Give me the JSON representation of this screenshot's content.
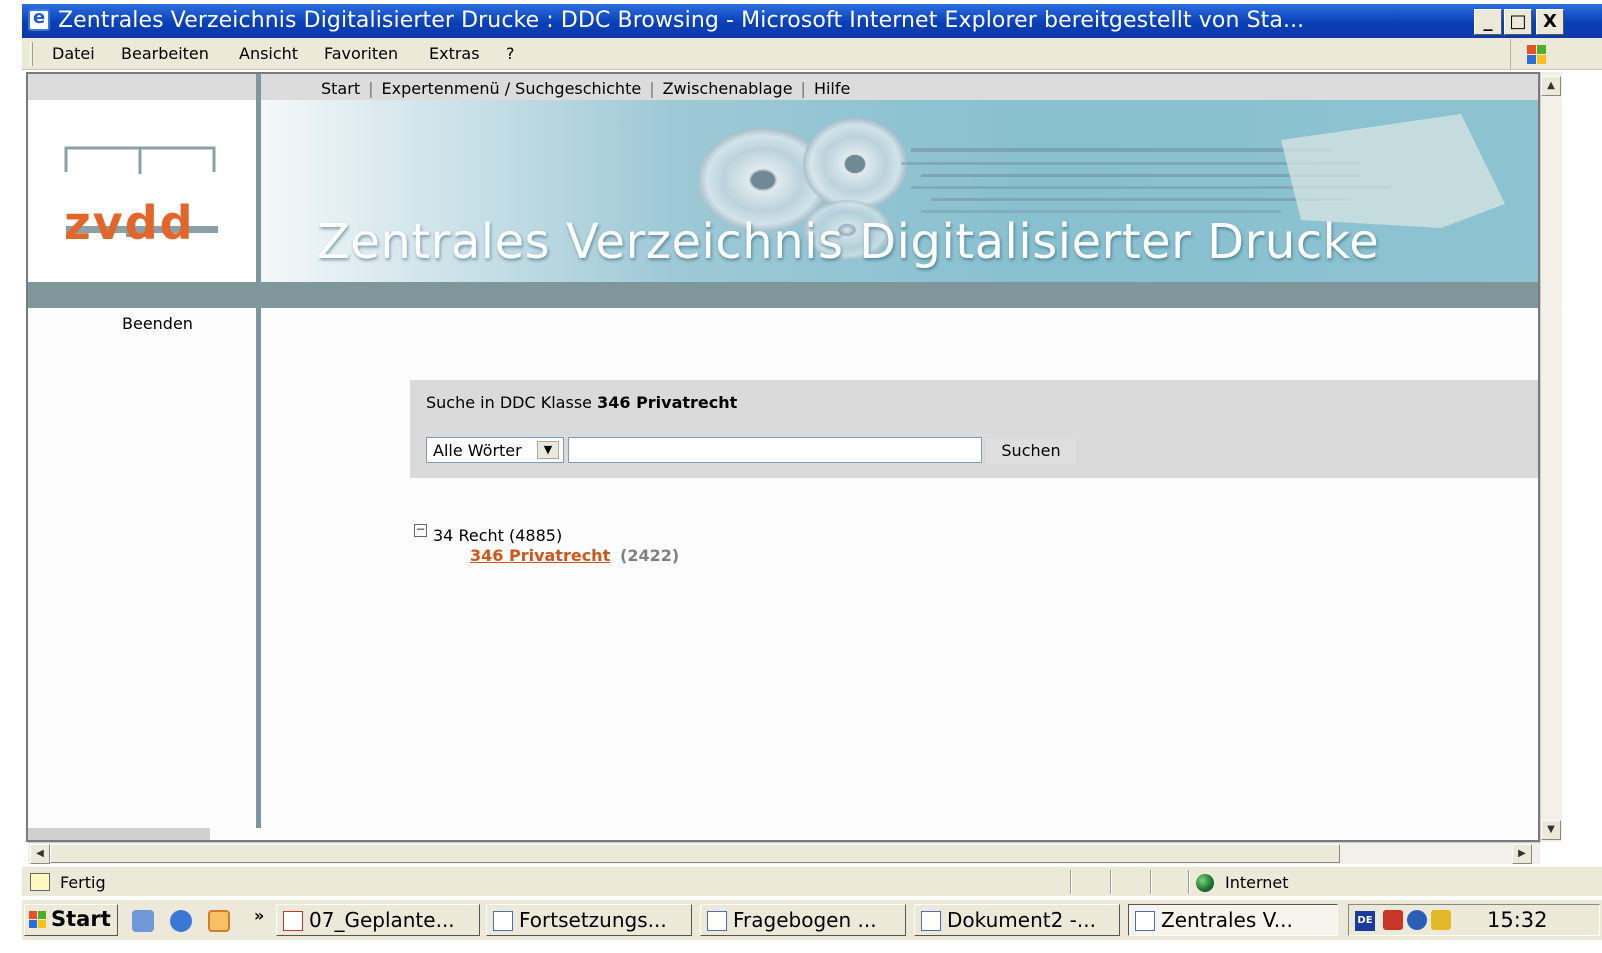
{
  "window": {
    "title": "Zentrales Verzeichnis Digitalisierter Drucke : DDC Browsing - Microsoft Internet Explorer bereitgestellt von Sta...",
    "buttons": {
      "minimize": "_",
      "maximize": "□",
      "close": "X"
    }
  },
  "menubar": {
    "items": [
      "Datei",
      "Bearbeiten",
      "Ansicht",
      "Favoriten",
      "Extras",
      "?"
    ]
  },
  "page": {
    "topnav": {
      "items": [
        "Start",
        "Expertenmenü / Suchgeschichte",
        "Zwischenablage",
        "Hilfe"
      ],
      "separator": "|"
    },
    "logo_text": "zvdd",
    "banner_title": "Zentrales Verzeichnis Digitalisierter Drucke",
    "sidebar": {
      "link": "Beenden"
    },
    "search": {
      "label_prefix": "Suche in DDC Klasse",
      "label_class": "346 Privatrecht",
      "mode_selected": "Alle Wörter",
      "query_value": "",
      "submit_label": "Suchen"
    },
    "tree": {
      "toggle": "−",
      "root_label": "34 Recht (4885)",
      "child_link": "346 Privatrecht",
      "child_count": "(2422)"
    }
  },
  "statusbar": {
    "text": "Fertig",
    "zone": "Internet"
  },
  "taskbar": {
    "start_label": "Start",
    "more": "»",
    "tasks": [
      {
        "label": "07_Geplante..."
      },
      {
        "label": "Fortsetzungs..."
      },
      {
        "label": "Fragebogen ..."
      },
      {
        "label": "Dokument2 -..."
      },
      {
        "label": "Zentrales V..."
      }
    ],
    "lang": "DE",
    "clock": "15:32"
  },
  "colors": {
    "accent_orange": "#e2662a",
    "link_orange": "#d0551c",
    "divider_blue_grey": "#7f969b",
    "title_bar_blue": "#0a3fb8"
  }
}
